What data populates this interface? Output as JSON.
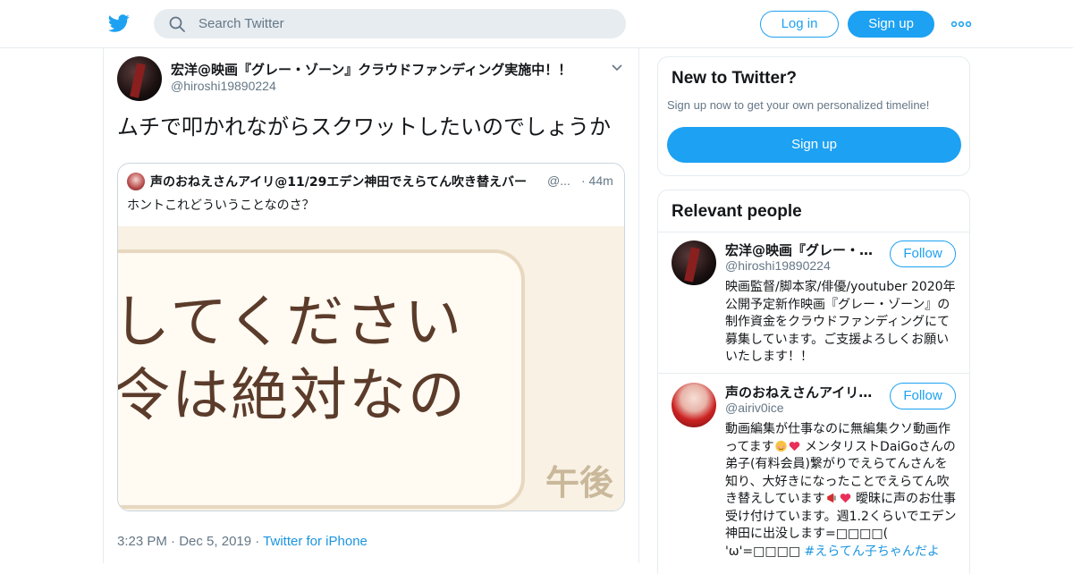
{
  "topbar": {
    "logo_icon": "twitter-bird-icon",
    "search_placeholder": "Search Twitter",
    "login_label": "Log in",
    "signup_label": "Sign up",
    "more_icon": "more-dots-icon"
  },
  "tweet": {
    "author_name": "宏洋@映画『グレー・ゾーン』クラウドファンディング実施中！！",
    "author_handle": "@hiroshi19890224",
    "text": "ムチで叩かれながらスクワットしたいのでしょうか",
    "quoted": {
      "author_name": "声のおねえさんアイリ@11/29エデン神田でえらてん吹き替えバー",
      "author_handle": "@...",
      "time": "· 44m",
      "text": "ホントこれどういうことなのさ？",
      "image_line1": "してください",
      "image_line2": "令は絶対なの",
      "image_corner": "午後"
    },
    "time": "3:23 PM",
    "date": "Dec 5, 2019",
    "source": "Twitter for iPhone",
    "separator": " · "
  },
  "new_to_twitter": {
    "title": "New to Twitter?",
    "subtitle": "Sign up now to get your own personalized timeline!",
    "button_label": "Sign up"
  },
  "relevant_people": {
    "title": "Relevant people",
    "people": [
      {
        "name": "宏洋@映画『グレー・…",
        "handle": "@hiroshi19890224",
        "follow_label": "Follow",
        "bio": "映画監督/脚本家/俳優/youtuber 2020年公開予定新作映画『グレー・ゾーン』の制作資金をクラウドファンディングにて募集しています。ご支援よろしくお願いいたします！！"
      },
      {
        "name": "声のおねえさんアイリ…",
        "handle": "@airiv0ice",
        "follow_label": "Follow",
        "bio_part1": "動画編集が仕事なのに無編集クソ動画作ってます",
        "bio_part2": " メンタリストDaiGoさんの弟子(有料会員)繋がりでえらてんさんを知り、大好きになったことでえらてん吹き替えしています",
        "bio_part3": " 曖昧に声のお仕事受け付けています。週1.2くらいでエデン神田に出没します=□□□□( 'ω'=□□□□ ",
        "bio_tag": "#えらてん子ちゃんだよ"
      }
    ]
  },
  "colors": {
    "brand_blue": "#1da1f2",
    "link_blue": "#1b95e0",
    "secondary_text": "#657786",
    "border": "#e6ecf0"
  }
}
